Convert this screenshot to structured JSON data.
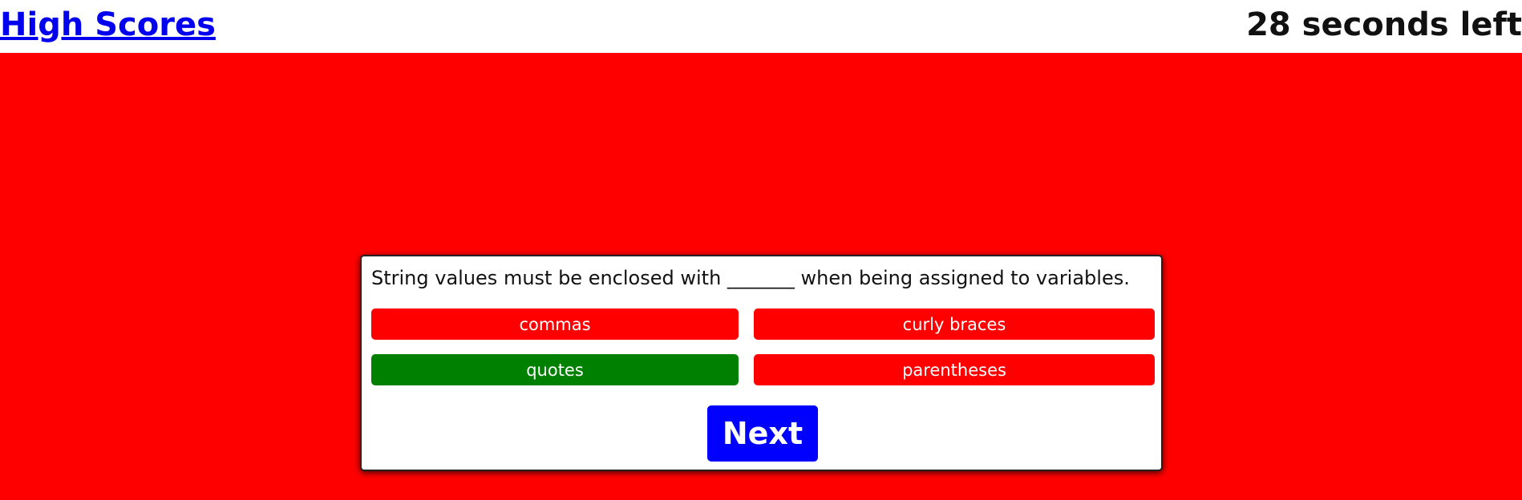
{
  "header": {
    "high_scores_label": "High Scores",
    "timer_text": "28 seconds left"
  },
  "quiz": {
    "question": "String values must be enclosed with _______ when being assigned to variables.",
    "answers": [
      {
        "label": "commas",
        "status": "incorrect"
      },
      {
        "label": "curly braces",
        "status": "incorrect"
      },
      {
        "label": "quotes",
        "status": "correct"
      },
      {
        "label": "parentheses",
        "status": "incorrect"
      }
    ],
    "next_label": "Next"
  },
  "colors": {
    "background": "#ff0000",
    "correct": "#008000",
    "incorrect": "#ff0000",
    "next_button": "#0000ff",
    "link": "#0000ee"
  }
}
